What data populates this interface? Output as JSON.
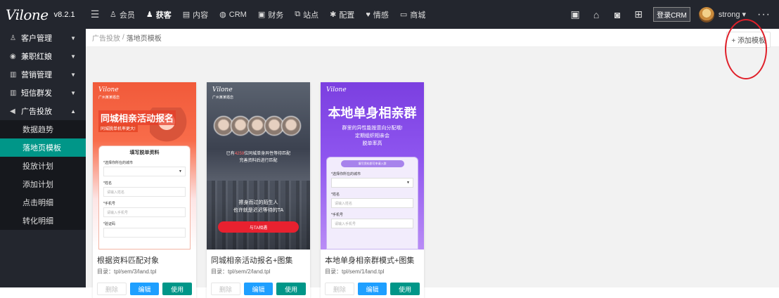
{
  "app": {
    "logo_text": "Vilone",
    "version": "v8.2.1"
  },
  "topnav": [
    {
      "icon": "user-group-icon",
      "glyph": "♙",
      "label": "会员",
      "active": false
    },
    {
      "icon": "customer-icon",
      "glyph": "♟",
      "label": "获客",
      "active": true
    },
    {
      "icon": "content-icon",
      "glyph": "▤",
      "label": "内容",
      "active": false
    },
    {
      "icon": "crm-icon",
      "glyph": "◍",
      "label": "CRM",
      "active": false
    },
    {
      "icon": "finance-icon",
      "glyph": "▣",
      "label": "财务",
      "active": false
    },
    {
      "icon": "site-icon",
      "glyph": "⧉",
      "label": "站点",
      "active": false
    },
    {
      "icon": "settings-icon",
      "glyph": "✱",
      "label": "配置",
      "active": false
    },
    {
      "icon": "heart-icon",
      "glyph": "♥",
      "label": "情感",
      "active": false
    },
    {
      "icon": "shop-icon",
      "glyph": "▭",
      "label": "商城",
      "active": false
    }
  ],
  "topright": {
    "crm_button": "登录CRM",
    "username": "strong"
  },
  "sidebar": {
    "groups": [
      {
        "label": "客户管理",
        "icon": "customers-icon",
        "glyph": "♙",
        "expanded": false
      },
      {
        "label": "兼职红娘",
        "icon": "matchmaker-icon",
        "glyph": "◉",
        "expanded": false
      },
      {
        "label": "营销管理",
        "icon": "marketing-icon",
        "glyph": "▥",
        "expanded": false
      },
      {
        "label": "短信群发",
        "icon": "sms-icon",
        "glyph": "▥",
        "expanded": false
      },
      {
        "label": "广告投放",
        "icon": "ads-icon",
        "glyph": "◀",
        "expanded": true
      }
    ],
    "sub_items": [
      {
        "label": "数据趋势",
        "active": false
      },
      {
        "label": "落地页模板",
        "active": true
      },
      {
        "label": "投放计划",
        "active": false
      },
      {
        "label": "添加计划",
        "active": false
      },
      {
        "label": "点击明细",
        "active": false
      },
      {
        "label": "转化明细",
        "active": false
      }
    ]
  },
  "breadcrumb": {
    "parent": "广告投放",
    "separator": "/",
    "current": "落地页模板"
  },
  "add_template_button": "+ 添加模板",
  "cards": [
    {
      "title": "根据资料匹配对象",
      "path": "目录：tpl/sem/3/land.tpl",
      "buttons": {
        "delete": "删除",
        "edit": "编辑",
        "use": "使用"
      },
      "preview": {
        "logo": "Vilone",
        "site": "广州某某婚恋",
        "headline": "同城相亲活动报名",
        "tag": "同城脱单机率更大!",
        "form_title": "填写脱单资料",
        "fields": [
          {
            "label": "*选择你所在的城市",
            "placeholder": ""
          },
          {
            "label": "*姓名",
            "placeholder": "请输入姓名"
          },
          {
            "label": "*手机号",
            "placeholder": "请输入手机号"
          },
          {
            "label": "*验证码",
            "placeholder": ""
          }
        ]
      }
    },
    {
      "title": "同城相亲活动报名+图集",
      "path": "目录：tpl/sem/2/land.tpl",
      "buttons": {
        "delete": "删除",
        "edit": "编辑",
        "use": "使用"
      },
      "preview": {
        "logo": "Vilone",
        "site": "广州某某婚恋",
        "line1_pre": "已有",
        "line1_num": "4259",
        "line1_post": "位同城单身异性等待匹配",
        "line2": "完善资料后进行匹配",
        "line3": "擦身而过的陌生人",
        "line4": "也许就是迟迟等待的TA",
        "button": "与TA相遇"
      }
    },
    {
      "title": "本地单身相亲群模式+图集",
      "path": "目录：tpl/sem/1/land.tpl",
      "buttons": {
        "delete": "删除",
        "edit": "编辑",
        "use": "使用"
      },
      "preview": {
        "logo": "Vilone",
        "headline": "本地单身相亲群",
        "line1": "群里的异性能按意向分配哦!",
        "line2": "定期组织相亲会",
        "line3": "脱单率高",
        "tip": "填写资料即可申请入群",
        "fields": [
          {
            "label": "*选择你所在的城市",
            "placeholder": ""
          },
          {
            "label": "*姓名",
            "placeholder": "请输入姓名"
          },
          {
            "label": "*手机号",
            "placeholder": "请输入手机号"
          }
        ]
      }
    }
  ],
  "colors": {
    "topbar": "#23262e",
    "active_item": "#009688",
    "edit_button": "#1e9fff",
    "annotation": "#e0202a"
  }
}
